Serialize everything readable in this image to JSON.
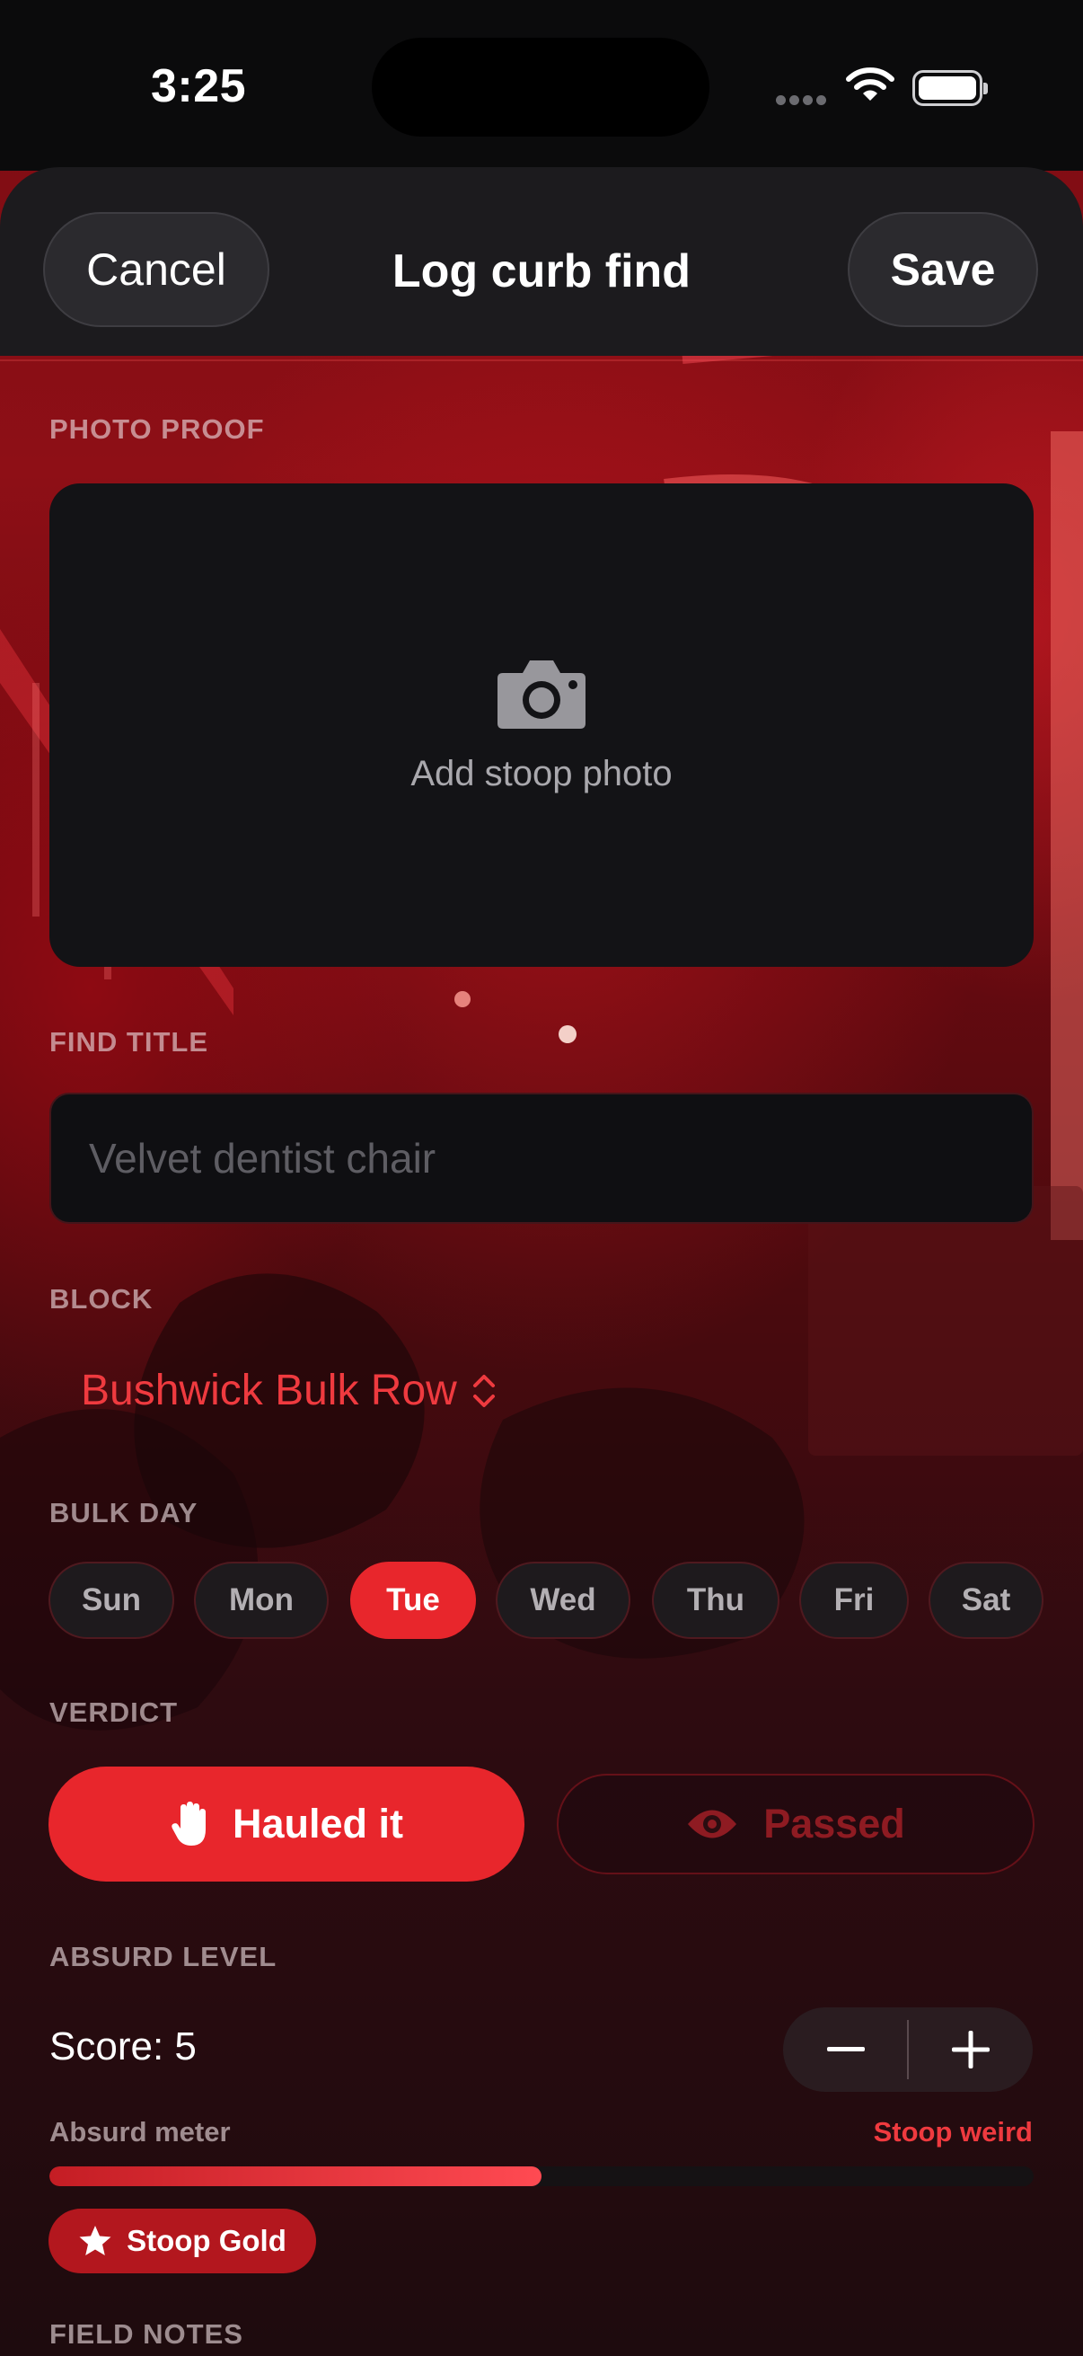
{
  "status_bar": {
    "time": "3:25"
  },
  "header": {
    "cancel_label": "Cancel",
    "title": "Log curb find",
    "save_label": "Save"
  },
  "photo": {
    "section_label": "PHOTO PROOF",
    "add_label": "Add stoop photo",
    "icon": "camera-icon"
  },
  "find_title": {
    "section_label": "FIND TITLE",
    "value": "",
    "placeholder": "Velvet dentist chair"
  },
  "block": {
    "section_label": "BLOCK",
    "selected": "Bushwick Bulk Row"
  },
  "bulk_day": {
    "section_label": "BULK DAY",
    "days": [
      "Sun",
      "Mon",
      "Tue",
      "Wed",
      "Thu",
      "Fri",
      "Sat"
    ],
    "selected": "Tue"
  },
  "verdict": {
    "section_label": "VERDICT",
    "options": [
      {
        "label": "Hauled it",
        "icon": "hand-raised-icon",
        "selected": true
      },
      {
        "label": "Passed",
        "icon": "eye-icon",
        "selected": false
      }
    ]
  },
  "absurd": {
    "section_label": "ABSURD LEVEL",
    "score_text": "Score: 5",
    "meter_label": "Absurd meter",
    "meter_level_label": "Stoop weird",
    "meter_fraction": 0.5,
    "badge_label": "Stoop Gold",
    "badge_icon": "star-icon"
  },
  "field_notes": {
    "section_label": "FIELD NOTES"
  },
  "colors": {
    "accent": "#e8262c",
    "background": "#140608",
    "card": "#131316"
  }
}
